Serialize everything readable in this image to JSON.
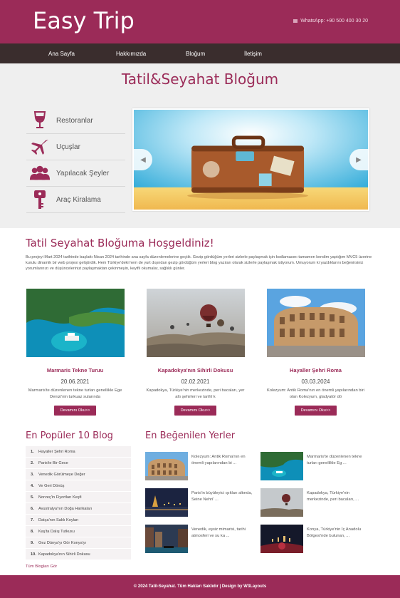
{
  "header": {
    "brand": "Easy Trip",
    "whatsapp": "WhatsApp: +90 500 400 30 20"
  },
  "nav": {
    "items": [
      "Ana Sayfa",
      "Hakkımızda",
      "Bloğum",
      "İletişim"
    ]
  },
  "hero": {
    "title": "Tatil&Seyahat Bloğum",
    "side_menu": [
      {
        "label": "Restoranlar",
        "icon": "wine-glass-icon"
      },
      {
        "label": "Uçuşlar",
        "icon": "airplane-icon"
      },
      {
        "label": "Yapılacak Şeyler",
        "icon": "people-icon"
      },
      {
        "label": "Araç Kiralama",
        "icon": "car-key-icon"
      }
    ],
    "slider_prev": "◀",
    "slider_next": "▶"
  },
  "welcome": {
    "title": "Tatil Seyahat Bloğuma Hoşgeldiniz!",
    "intro": "Bu projeyi Mart 2024 tarihinde başlattı Nisan 2024 tarihinde ana sayfa düzenlemelerine geçtik. Gezip gördüğüm yerleri sizlerle paylaşmak için kodlamasını tamamen kendim yaptığım MVC5 üzerine kurulu dinamik bir web projesi geliştirdik. Hem Türkiye'deki hem de yurt dışından gezip gördüğüm yerleri blog yazıları olarak sizlerle paylaşmak istiyorum. Umuyorum ki yazdıklarını beğenirsiniz yorumlarınızı ve düşüncelerinizi paylaşmaktan çekinmeyin, keyifli okumalar, sağlıklı günler."
  },
  "cards": [
    {
      "title": "Marmaris Tekne Turuu",
      "date": "20.06.2021",
      "text": "Marmaris'te düzenlenen tekne turları genellikle Ege Denizi'nin turkuaz sularında",
      "button": "Devamını Oku>>"
    },
    {
      "title": "Kapadokya'nın Sihirli Dokusu",
      "date": "02.02.2021",
      "text": "Kapadokya, Türkiye'nin merkezinde, peri bacaları, yer altı şehirleri ve tarihî k",
      "button": "Devamını Oku>>"
    },
    {
      "title": "Hayaller Şehri Roma",
      "date": "03.03.2024",
      "text": "Kolezyum: Antik Roma'nın en önemli yapılarından biri olan Kolezyum, gladyatör dö",
      "button": "Devamını Oku>>"
    }
  ],
  "popular": {
    "title": "En Popüler 10 Blog",
    "items": [
      {
        "num": "1.",
        "label": "Hayaller Şehri Roma"
      },
      {
        "num": "2.",
        "label": "Paris'te Bir Gece"
      },
      {
        "num": "3.",
        "label": "Venedik Görülmeye Değer"
      },
      {
        "num": "4.",
        "label": "Ve Geri Dönüş"
      },
      {
        "num": "5.",
        "label": "Norveç'in Fiyortları Keşfi"
      },
      {
        "num": "6.",
        "label": "Avustralya'nın Doğa Harikaları"
      },
      {
        "num": "7.",
        "label": "Datça'nın Saklı Koyları"
      },
      {
        "num": "8.",
        "label": "Kaş'ta Dalış Tutkusu"
      },
      {
        "num": "9.",
        "label": "Gez Dünya'yı Gör Konya'yı"
      },
      {
        "num": "10.",
        "label": "Kapadokya'nın Sihirli Dokusu"
      }
    ],
    "all_link": "Tüm Blogları Gör"
  },
  "liked": {
    "title": "En Beğenilen Yerler",
    "items": [
      {
        "text": "Kolezyum: Antik Roma'nın en önemli yapılarından bi ..."
      },
      {
        "text": "Marmaris'te düzenlenen tekne turları genellikle Eg ..."
      },
      {
        "text": "Paris'in büyüleyici ışıkları altında, Seine Nehri' ..."
      },
      {
        "text": "Kapadokya, Türkiye'nin merkezinde, peri bacaları, ..."
      },
      {
        "text": "Venedik, eşsiz mimarisi, tarihi atmosferi ve su ka ..."
      },
      {
        "text": "Konya, Türkiye'nin İç Anadolu Bölgesi'nde bulunan, ..."
      }
    ]
  },
  "footer": {
    "text": "© 2024 Tatil-Seyahat. Tüm Hakları Saklıdır | Design by W3Layouts"
  },
  "colors": {
    "brand": "#9b2b58",
    "nav_bg": "#3a2d2d"
  }
}
